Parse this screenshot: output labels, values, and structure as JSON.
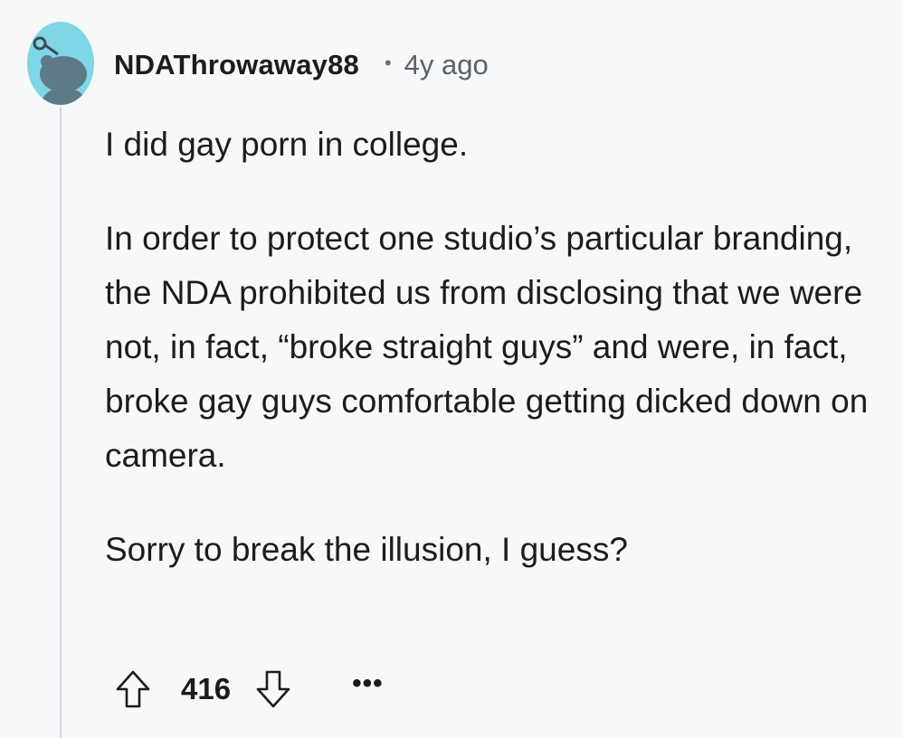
{
  "comment": {
    "author": "NDAThrowaway88",
    "separator": "•",
    "timestamp": "4y ago",
    "paragraphs": [
      "I did gay porn in college.",
      "In order to protect one studio’s particular branding, the NDA prohibited us from disclosing that we were not, in fact, “broke straight guys” and were, in fact, broke gay guys comfortable getting dicked down on camera.",
      "Sorry to break the illusion, I guess?"
    ],
    "score": "416",
    "more_label": "•••",
    "icons": {
      "avatar": "snoo-avatar",
      "upvote": "upvote-arrow-icon",
      "downvote": "downvote-arrow-icon",
      "more": "more-options-icon"
    },
    "colors": {
      "avatar_bg": "#7fd6e6",
      "background": "#f7f8fa",
      "thread_line": "#d5d7db"
    }
  }
}
